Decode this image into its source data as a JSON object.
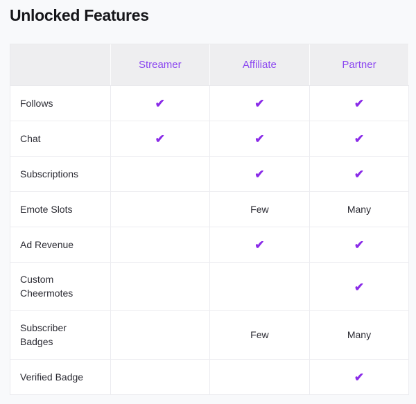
{
  "page": {
    "title": "Unlocked Features",
    "background_color": "#f8f9fb"
  },
  "theme": {
    "accent_purple": "#8b47f0",
    "check_purple": "#8a2be8",
    "header_background": "#eeeef0",
    "cell_background": "#ffffff",
    "border_color": "#ececf0",
    "text_color": "#2b2b33",
    "title_color": "#16161a"
  },
  "table": {
    "columns": [
      {
        "key": "feature",
        "label": ""
      },
      {
        "key": "streamer",
        "label": "Streamer"
      },
      {
        "key": "affiliate",
        "label": "Affiliate"
      },
      {
        "key": "partner",
        "label": "Partner"
      }
    ],
    "check_glyph": "✔",
    "rows": [
      {
        "feature": "Follows",
        "lines": 1,
        "streamer": {
          "type": "check",
          "text": "✔"
        },
        "affiliate": {
          "type": "check",
          "text": "✔"
        },
        "partner": {
          "type": "check",
          "text": "✔"
        }
      },
      {
        "feature": "Chat",
        "lines": 1,
        "streamer": {
          "type": "check",
          "text": "✔"
        },
        "affiliate": {
          "type": "check",
          "text": "✔"
        },
        "partner": {
          "type": "check",
          "text": "✔"
        }
      },
      {
        "feature": "Subscriptions",
        "lines": 1,
        "streamer": {
          "type": "empty",
          "text": ""
        },
        "affiliate": {
          "type": "check",
          "text": "✔"
        },
        "partner": {
          "type": "check",
          "text": "✔"
        }
      },
      {
        "feature": "Emote Slots",
        "lines": 1,
        "streamer": {
          "type": "empty",
          "text": ""
        },
        "affiliate": {
          "type": "text",
          "text": "Few"
        },
        "partner": {
          "type": "text",
          "text": "Many"
        }
      },
      {
        "feature": "Ad Revenue",
        "lines": 1,
        "streamer": {
          "type": "empty",
          "text": ""
        },
        "affiliate": {
          "type": "check",
          "text": "✔"
        },
        "partner": {
          "type": "check",
          "text": "✔"
        }
      },
      {
        "feature": "Custom Cheermotes",
        "lines": 2,
        "streamer": {
          "type": "empty",
          "text": ""
        },
        "affiliate": {
          "type": "empty",
          "text": ""
        },
        "partner": {
          "type": "check",
          "text": "✔"
        }
      },
      {
        "feature": "Subscriber Badges",
        "lines": 2,
        "streamer": {
          "type": "empty",
          "text": ""
        },
        "affiliate": {
          "type": "text",
          "text": "Few"
        },
        "partner": {
          "type": "text",
          "text": "Many"
        }
      },
      {
        "feature": "Verified Badge",
        "lines": 1,
        "streamer": {
          "type": "empty",
          "text": ""
        },
        "affiliate": {
          "type": "empty",
          "text": ""
        },
        "partner": {
          "type": "check",
          "text": "✔"
        }
      }
    ]
  }
}
